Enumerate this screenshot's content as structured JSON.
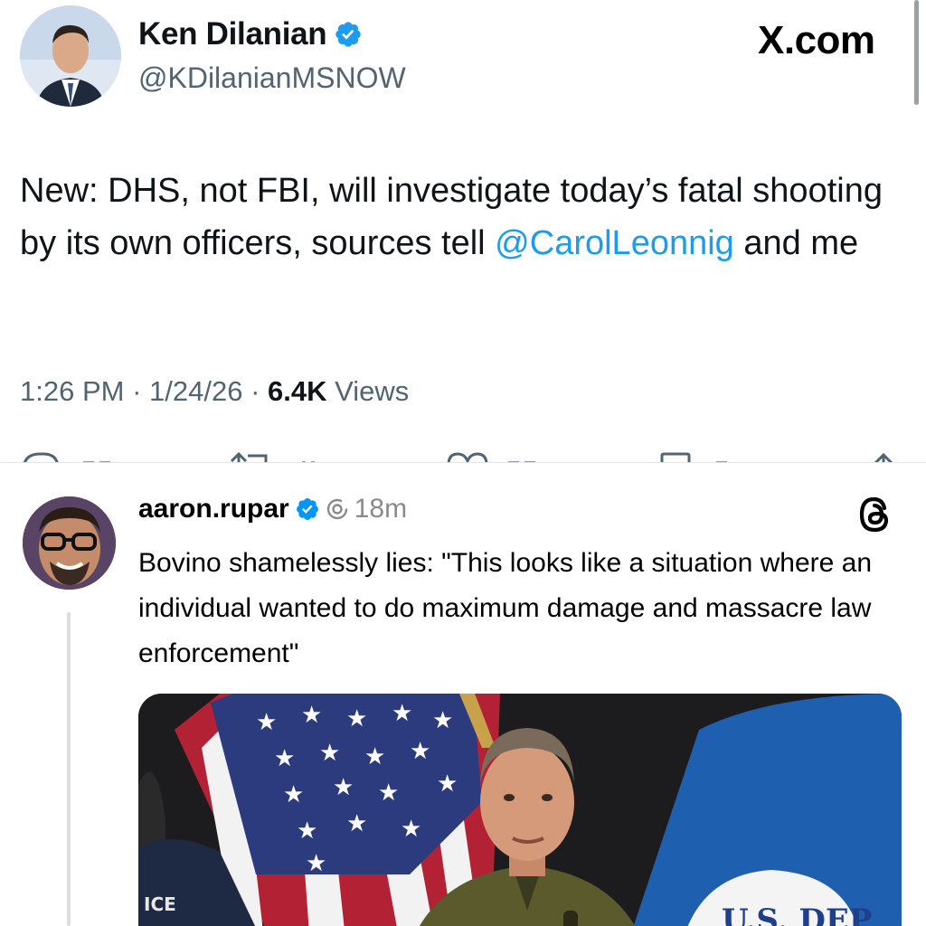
{
  "tweet": {
    "author_name": "Ken Dilanian",
    "handle": "@KDilanianMSNOW",
    "site": "X.com",
    "text_before": "New: DHS, not FBI, will investigate today’s fatal shooting by its own officers, sources tell ",
    "mention": "@CarolLeonnig",
    "text_after": " and me",
    "time": "1:26 PM",
    "date": "1/24/26",
    "views_count": "6.4K",
    "views_label": "Views",
    "separator": " · ",
    "icons": [
      "verified-badge-icon",
      "reply-icon",
      "retweet-icon",
      "like-icon",
      "bookmark-icon",
      "share-icon"
    ],
    "colors": {
      "mention": "#1d9bf0",
      "verified": "#1d9bf0",
      "meta": "#536471"
    }
  },
  "threads_post": {
    "username": "aaron.rupar",
    "time": "18m",
    "text": "Bovino shamelessly lies: \"This looks like a situation where an individual wanted to do maximum damage and massacre law enforcement\"",
    "icons": [
      "verified-badge-icon",
      "threads-logo-icon"
    ],
    "image": {
      "description_labels": {
        "jacket_text": "ICE",
        "seal_text": "U.S. DEP"
      }
    }
  }
}
